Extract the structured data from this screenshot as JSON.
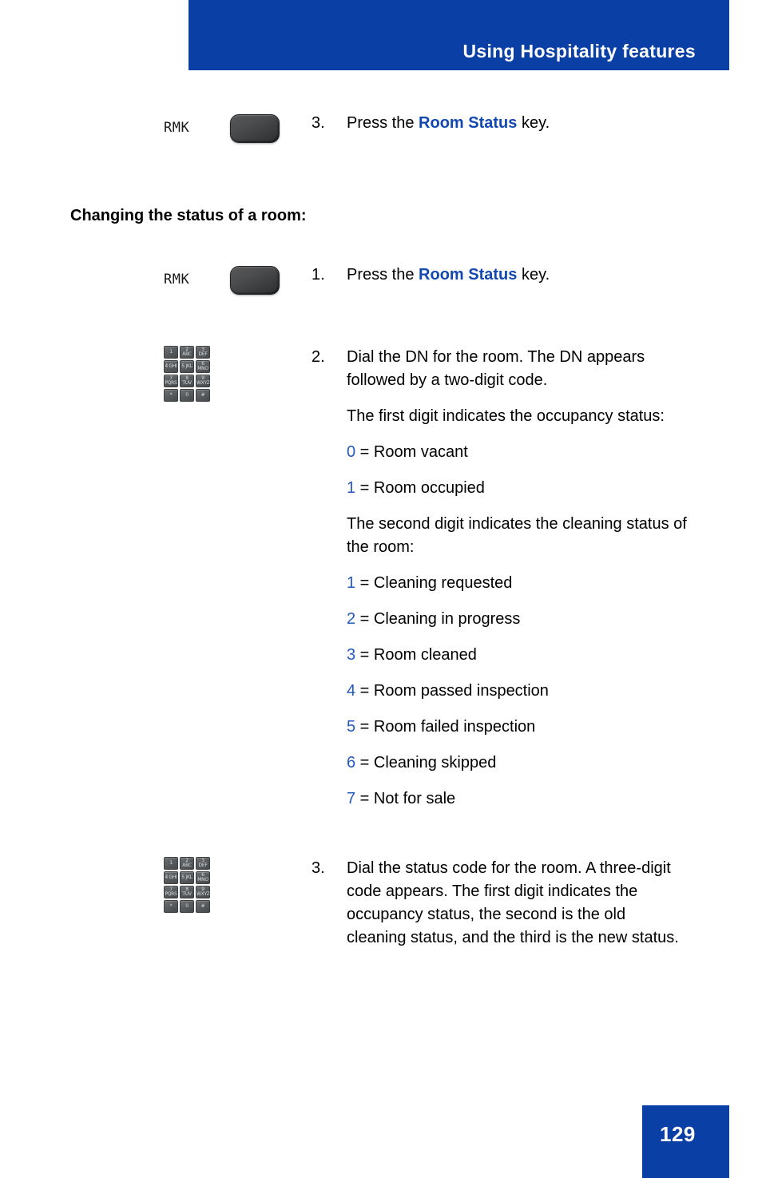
{
  "header": {
    "title": "Using Hospitality features",
    "bar_color": "#0A3FA5"
  },
  "colors": {
    "brand_blue": "#0A3FA5",
    "link_blue": "#1248B0",
    "digit_blue": "#2358BC"
  },
  "section_heading": "Changing the status of a room:",
  "icons": {
    "feature_key_label": "RMK",
    "dialpad_keys": [
      "1",
      "2 ABC",
      "3 DEF",
      "4 GHI",
      "5 JKL",
      "6 MNO",
      "7 PQRS",
      "8 TUV",
      "9 WXYZ",
      "*",
      "0",
      "#"
    ]
  },
  "steps": [
    {
      "number": "3.",
      "icon": "feature-key",
      "text_before": "Press the ",
      "bold_blue": "Room Status",
      "text_after": " key."
    },
    {
      "number": "1.",
      "icon": "feature-key",
      "text_before": "Press the ",
      "bold_blue": "Room Status",
      "text_after": " key."
    },
    {
      "number": "2.",
      "icon": "dialpad",
      "para1": "Dial the DN for the room. The DN appears followed by a two-digit code.",
      "para2": "The first digit indicates the occupancy status:",
      "occupancy_codes": [
        {
          "digit": "0",
          "desc": " = Room vacant"
        },
        {
          "digit": "1",
          "desc": " = Room occupied"
        }
      ],
      "para3": "The second digit indicates the cleaning status of the room:",
      "cleaning_codes": [
        {
          "digit": "1",
          "desc": " = Cleaning requested"
        },
        {
          "digit": "2",
          "desc": " = Cleaning in progress"
        },
        {
          "digit": "3",
          "desc": " = Room cleaned"
        },
        {
          "digit": "4",
          "desc": " = Room passed inspection"
        },
        {
          "digit": "5",
          "desc": " = Room failed inspection"
        },
        {
          "digit": "6",
          "desc": " = Cleaning skipped"
        },
        {
          "digit": "7",
          "desc": " = Not for sale"
        }
      ]
    },
    {
      "number": "3.",
      "icon": "dialpad",
      "para1": "Dial the status code for the room. A three-digit code appears. The first digit indicates the occupancy status, the second is the old cleaning status, and the third is the new status."
    }
  ],
  "footer": {
    "page_number": "129"
  }
}
